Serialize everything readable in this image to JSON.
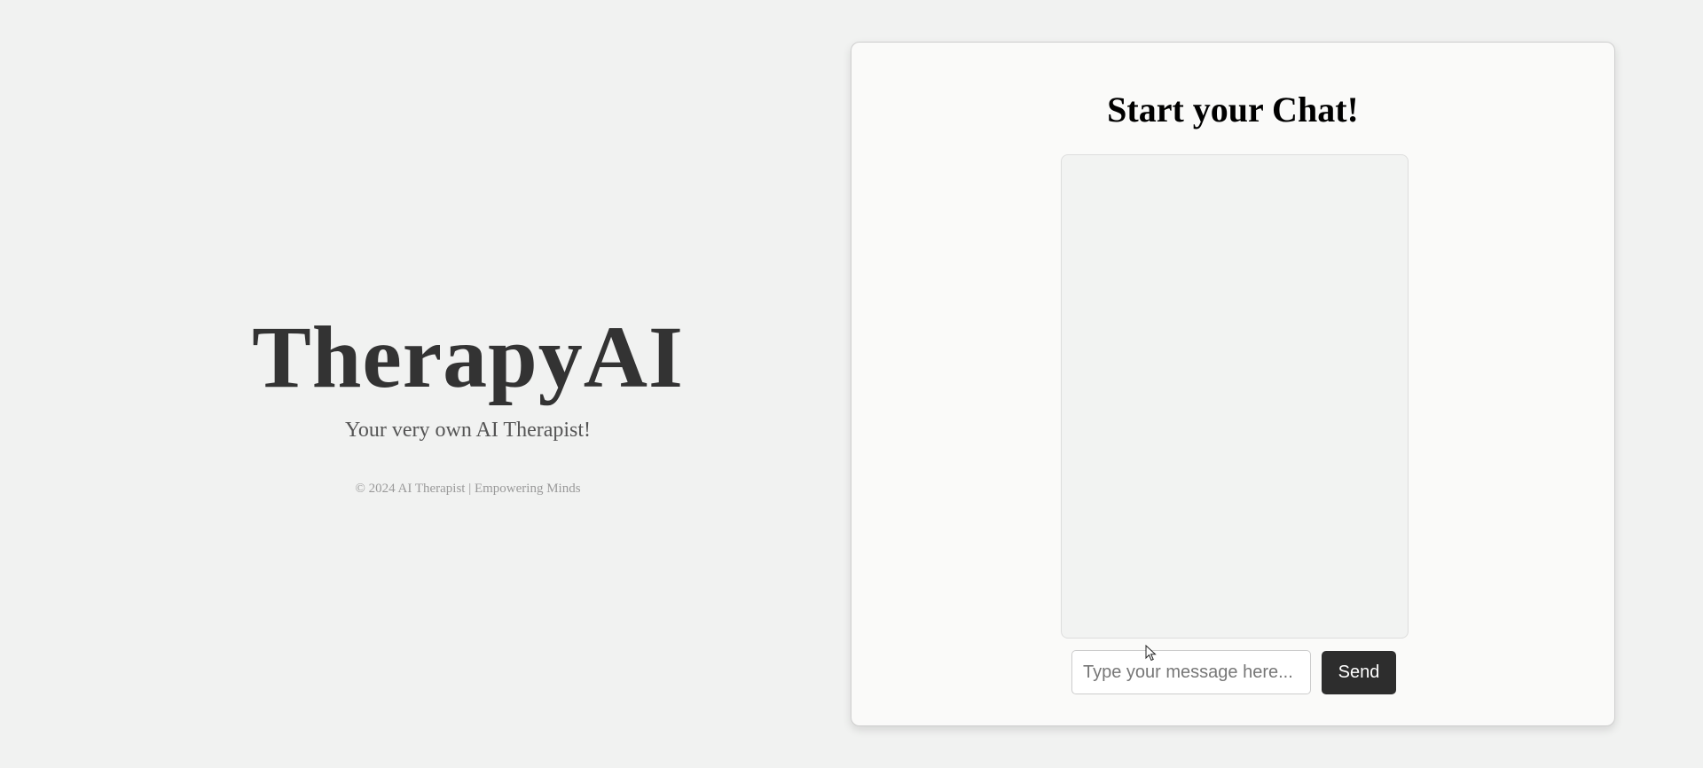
{
  "hero": {
    "title": "TherapyAI",
    "tagline": "Your very own AI Therapist!",
    "footer": "© 2024 AI Therapist | Empowering Minds"
  },
  "chat": {
    "heading": "Start your Chat!",
    "messages": [],
    "input": {
      "value": "",
      "placeholder": "Type your message here..."
    },
    "send_label": "Send"
  },
  "colors": {
    "background": "#f1f2f1",
    "card": "#fafaf9",
    "button": "#2d2d2d",
    "title": "#333333"
  },
  "icons": {
    "cursor": "mouse-pointer-icon"
  }
}
